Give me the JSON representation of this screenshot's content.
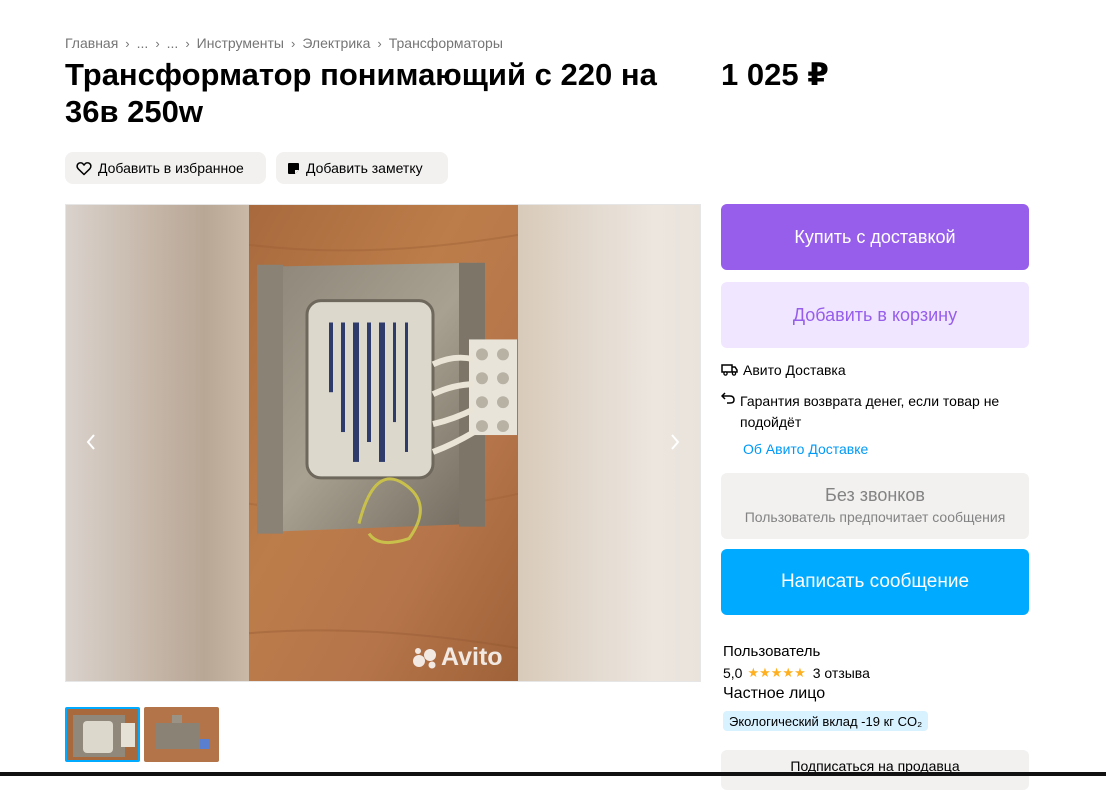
{
  "breadcrumb": [
    "Главная",
    "...",
    "...",
    "Инструменты",
    "Электрика",
    "Трансформаторы"
  ],
  "listing": {
    "title": "Трансформатор понимающий с 220 на 36в 250w",
    "price": "1 025 ₽"
  },
  "actions": {
    "favorite_label": "Добавить в избранное",
    "note_label": "Добавить заметку"
  },
  "gallery": {
    "watermark": "Avito",
    "thumbnail_count": 2,
    "selected_thumbnail": 1
  },
  "purchase": {
    "buy_label": "Купить с доставкой",
    "cart_label": "Добавить в корзину"
  },
  "delivery": {
    "service": "Авито Доставка",
    "guarantee": "Гарантия возврата денег, если товар не подойдёт",
    "link": "Об Авито Доставке"
  },
  "contact": {
    "no_calls_title": "Без звонков",
    "no_calls_subtitle": "Пользователь предпочитает сообщения",
    "message_label": "Написать сообщение"
  },
  "seller": {
    "name": "Пользователь",
    "rating": "5,0",
    "stars": 5,
    "reviews": "3 отзыва",
    "type": "Частное лицо",
    "eco_badge": "Экологический вклад -19 кг CO₂",
    "subscribe_label": "Подписаться на продавца"
  },
  "colors": {
    "purple": "#965eeb",
    "purple_light": "#f1e6ff",
    "blue": "#00aaff",
    "link": "#0099f7",
    "star": "#ffb021"
  }
}
